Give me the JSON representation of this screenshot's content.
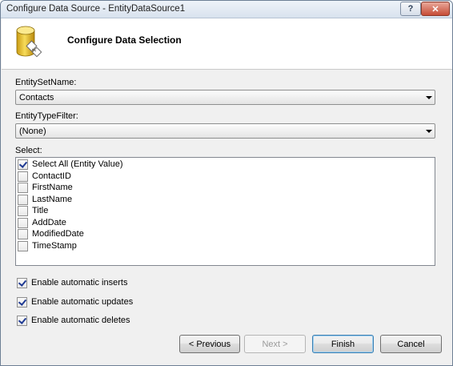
{
  "window": {
    "title": "Configure Data Source - EntityDataSource1",
    "help_label": "?",
    "close_label": "✕"
  },
  "header": {
    "title": "Configure Data Selection",
    "icon": "database-wizard-icon"
  },
  "entity_set": {
    "label": "EntitySetName:",
    "value": "Contacts"
  },
  "entity_type_filter": {
    "label": "EntityTypeFilter:",
    "value": "(None)"
  },
  "select": {
    "label": "Select:",
    "items": [
      {
        "label": "Select All (Entity Value)",
        "checked": true
      },
      {
        "label": "ContactID",
        "checked": false
      },
      {
        "label": "FirstName",
        "checked": false
      },
      {
        "label": "LastName",
        "checked": false
      },
      {
        "label": "Title",
        "checked": false
      },
      {
        "label": "AddDate",
        "checked": false
      },
      {
        "label": "ModifiedDate",
        "checked": false
      },
      {
        "label": "TimeStamp",
        "checked": false
      }
    ]
  },
  "options": [
    {
      "label": "Enable automatic inserts",
      "checked": true
    },
    {
      "label": "Enable automatic updates",
      "checked": true
    },
    {
      "label": "Enable automatic deletes",
      "checked": true
    }
  ],
  "buttons": {
    "previous": "< Previous",
    "next": "Next >",
    "finish": "Finish",
    "cancel": "Cancel"
  }
}
